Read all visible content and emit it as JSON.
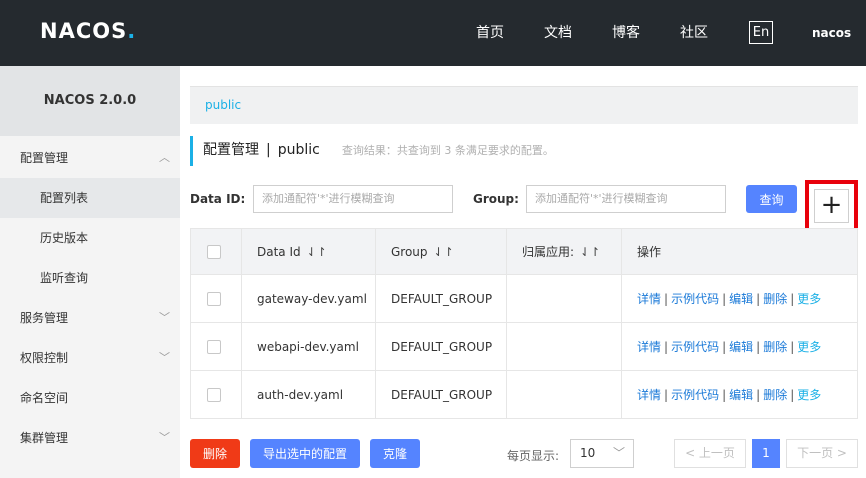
{
  "header": {
    "logo_main": "NACOS",
    "logo_dot": ".",
    "nav": [
      "首页",
      "文档",
      "博客",
      "社区"
    ],
    "lang": "En",
    "user": "nacos"
  },
  "sidebar": {
    "title": "NACOS 2.0.0",
    "items": [
      {
        "label": "配置管理",
        "expanded": true
      },
      {
        "label": "配置列表",
        "active": true
      },
      {
        "label": "历史版本"
      },
      {
        "label": "监听查询"
      },
      {
        "label": "服务管理"
      },
      {
        "label": "权限控制"
      },
      {
        "label": "命名空间"
      },
      {
        "label": "集群管理"
      }
    ]
  },
  "breadcrumb": "public",
  "page": {
    "title": "配置管理",
    "separator": "|",
    "namespace": "public",
    "result_hint": "查询结果：共查询到 3 条满足要求的配置。"
  },
  "search": {
    "dataid_label": "Data ID:",
    "dataid_placeholder": "添加通配符'*'进行模糊查询",
    "group_label": "Group:",
    "group_placeholder": "添加通配符'*'进行模糊查询",
    "query_button": "查询",
    "add_button": "+"
  },
  "table": {
    "headers": [
      "Data Id",
      "Group",
      "归属应用:",
      "操作"
    ],
    "sort_glyph": "⇃↾",
    "rows": [
      {
        "data_id": "gateway-dev.yaml",
        "group": "DEFAULT_GROUP",
        "app": ""
      },
      {
        "data_id": "webapi-dev.yaml",
        "group": "DEFAULT_GROUP",
        "app": ""
      },
      {
        "data_id": "auth-dev.yaml",
        "group": "DEFAULT_GROUP",
        "app": ""
      }
    ],
    "ops": {
      "detail": "详情",
      "sample": "示例代码",
      "edit": "编辑",
      "delete": "删除",
      "more": "更多",
      "bar": "|"
    }
  },
  "footer": {
    "delete_button": "删除",
    "export_button": "导出选中的配置",
    "clone_button": "克隆",
    "page_size_label": "每页显示:",
    "page_size": "10",
    "prev": "< 上一页",
    "current_page": "1",
    "next": "下一页 >"
  },
  "colors": {
    "accent": "#1bb0e6",
    "primary": "#5584ff",
    "danger": "#f03a17",
    "highlight_frame": "#e8000b"
  }
}
